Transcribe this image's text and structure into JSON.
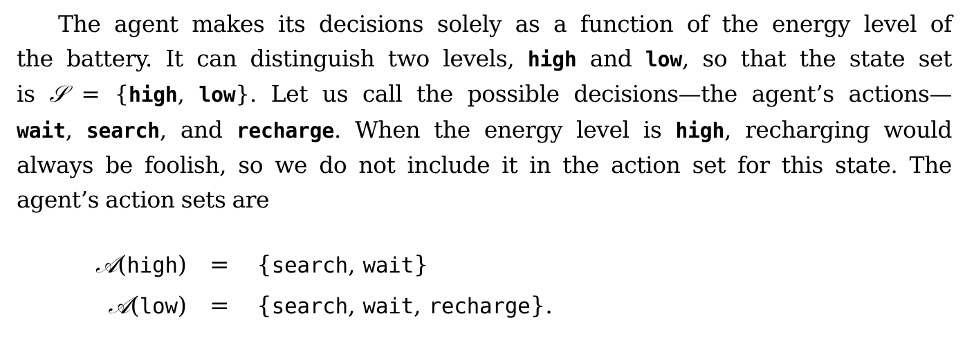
{
  "paragraph": {
    "line1": "The agent makes its decisions solely as a function of the energy level of",
    "line2_a": "the battery. It can distinguish two levels, ",
    "line2_high": "high",
    "line2_b": " and ",
    "line2_low": "low",
    "line2_c": ", so that the state set",
    "line3_a": "is ",
    "line3_S": "𝒮",
    "line3_eq": " = {",
    "line3_high": "high",
    "line3_comma": ", ",
    "line3_low": "low",
    "line3_b": "}.  Let us call the possible decisions—the agent’s actions—",
    "line4_wait": "wait",
    "line4_comma": ", ",
    "line4_search": "search",
    "line4_and": ", and ",
    "line4_recharge": "recharge",
    "line4_b": ".  When the energy level is ",
    "line4_high": "high",
    "line4_c": ", recharging would",
    "line5": "always be foolish, so we do not include it in the action set for this state.  The",
    "line6": "agent’s action sets are"
  },
  "equations": [
    {
      "lhs_A": "𝒜",
      "lhs_open": "(",
      "lhs_state": "high",
      "lhs_close": ")",
      "eq": "=",
      "rhs_open": "{",
      "rhs_a1": "search",
      "rhs_sep1": ", ",
      "rhs_a2": "wait",
      "rhs_close": "}"
    },
    {
      "lhs_A": "𝒜",
      "lhs_open": "(",
      "lhs_state": "low",
      "lhs_close": ")",
      "eq": "=",
      "rhs_open": "{",
      "rhs_a1": "search",
      "rhs_sep1": ", ",
      "rhs_a2": "wait",
      "rhs_sep2": ", ",
      "rhs_a3": "recharge",
      "rhs_close": "}."
    }
  ]
}
